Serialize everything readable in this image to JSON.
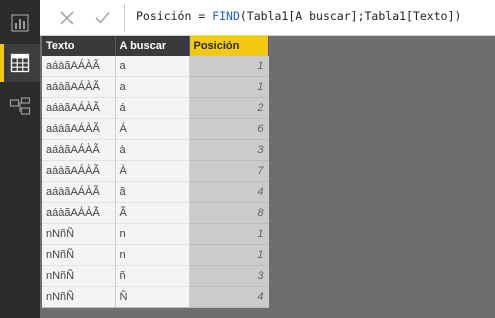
{
  "nav": {
    "items": [
      {
        "name": "report-view",
        "icon": "bar-chart-icon"
      },
      {
        "name": "data-view",
        "icon": "table-icon",
        "active": true
      },
      {
        "name": "relationships-view",
        "icon": "relationships-icon"
      }
    ]
  },
  "formula_bar": {
    "cancel_icon": "close-icon",
    "commit_icon": "checkmark-icon",
    "column_name": "Posición",
    "operator": " = ",
    "function": "FIND",
    "args": "(Tabla1[A buscar];Tabla1[Texto])"
  },
  "table": {
    "columns": [
      "Texto",
      "A buscar",
      "Posición"
    ],
    "highlighted_column": "Posición",
    "rows": [
      [
        "aáàãAÁÀÃ",
        "a",
        "1"
      ],
      [
        "aáàãAÁÀÃ",
        "a",
        "1"
      ],
      [
        "aáàãAÁÀÃ",
        "á",
        "2"
      ],
      [
        "aáàãAÁÀÃ",
        "Á",
        "6"
      ],
      [
        "aáàãAÁÀÃ",
        "à",
        "3"
      ],
      [
        "aáàãAÁÀÃ",
        "À",
        "7"
      ],
      [
        "aáàãAÁÀÃ",
        "ã",
        "4"
      ],
      [
        "aáàãAÁÀÃ",
        "Ã",
        "8"
      ],
      [
        "nNñÑ",
        "n",
        "1"
      ],
      [
        "nNñÑ",
        "n",
        "1"
      ],
      [
        "nNñÑ",
        "ñ",
        "3"
      ],
      [
        "nNñÑ",
        "Ñ",
        "4"
      ]
    ]
  },
  "colors": {
    "accent": "#f2c811",
    "rail": "#2b2b2b",
    "canvas": "#6e6e6e",
    "function": "#1a64c8"
  }
}
